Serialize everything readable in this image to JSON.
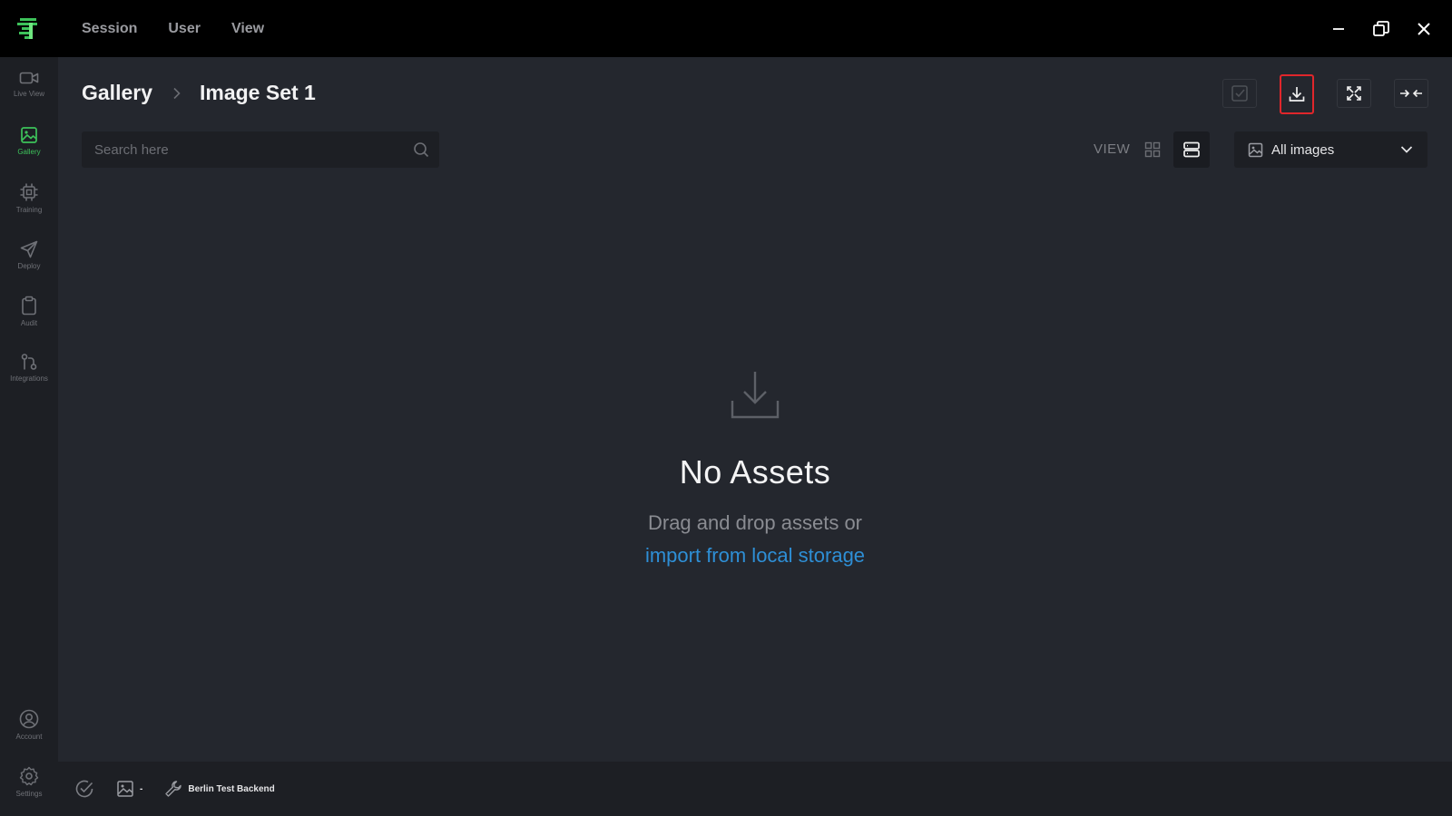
{
  "menu": {
    "session": "Session",
    "user": "User",
    "view": "View"
  },
  "sidebar": {
    "items": [
      {
        "label": "Live View",
        "icon": "video-icon"
      },
      {
        "label": "Gallery",
        "icon": "image-icon",
        "active": true
      },
      {
        "label": "Training",
        "icon": "chip-icon"
      },
      {
        "label": "Deploy",
        "icon": "send-icon"
      },
      {
        "label": "Audit",
        "icon": "clipboard-icon"
      },
      {
        "label": "Integrations",
        "icon": "integrations-icon"
      }
    ],
    "bottom": [
      {
        "label": "Account",
        "icon": "account-icon"
      },
      {
        "label": "Settings",
        "icon": "gear-icon"
      }
    ]
  },
  "breadcrumb": {
    "root": "Gallery",
    "current": "Image Set 1"
  },
  "search": {
    "placeholder": "Search here",
    "value": ""
  },
  "view": {
    "label": "VIEW",
    "mode": "list"
  },
  "filter": {
    "selected": "All images"
  },
  "empty": {
    "title": "No Assets",
    "subtitle": "Drag and drop assets or",
    "link": "import from local storage"
  },
  "status": {
    "image_count": "-",
    "backend": "Berlin Test Backend"
  },
  "colors": {
    "accent": "#3dc25a",
    "link": "#2e8fd6",
    "highlight": "#e0262b",
    "background": "#24272e"
  }
}
